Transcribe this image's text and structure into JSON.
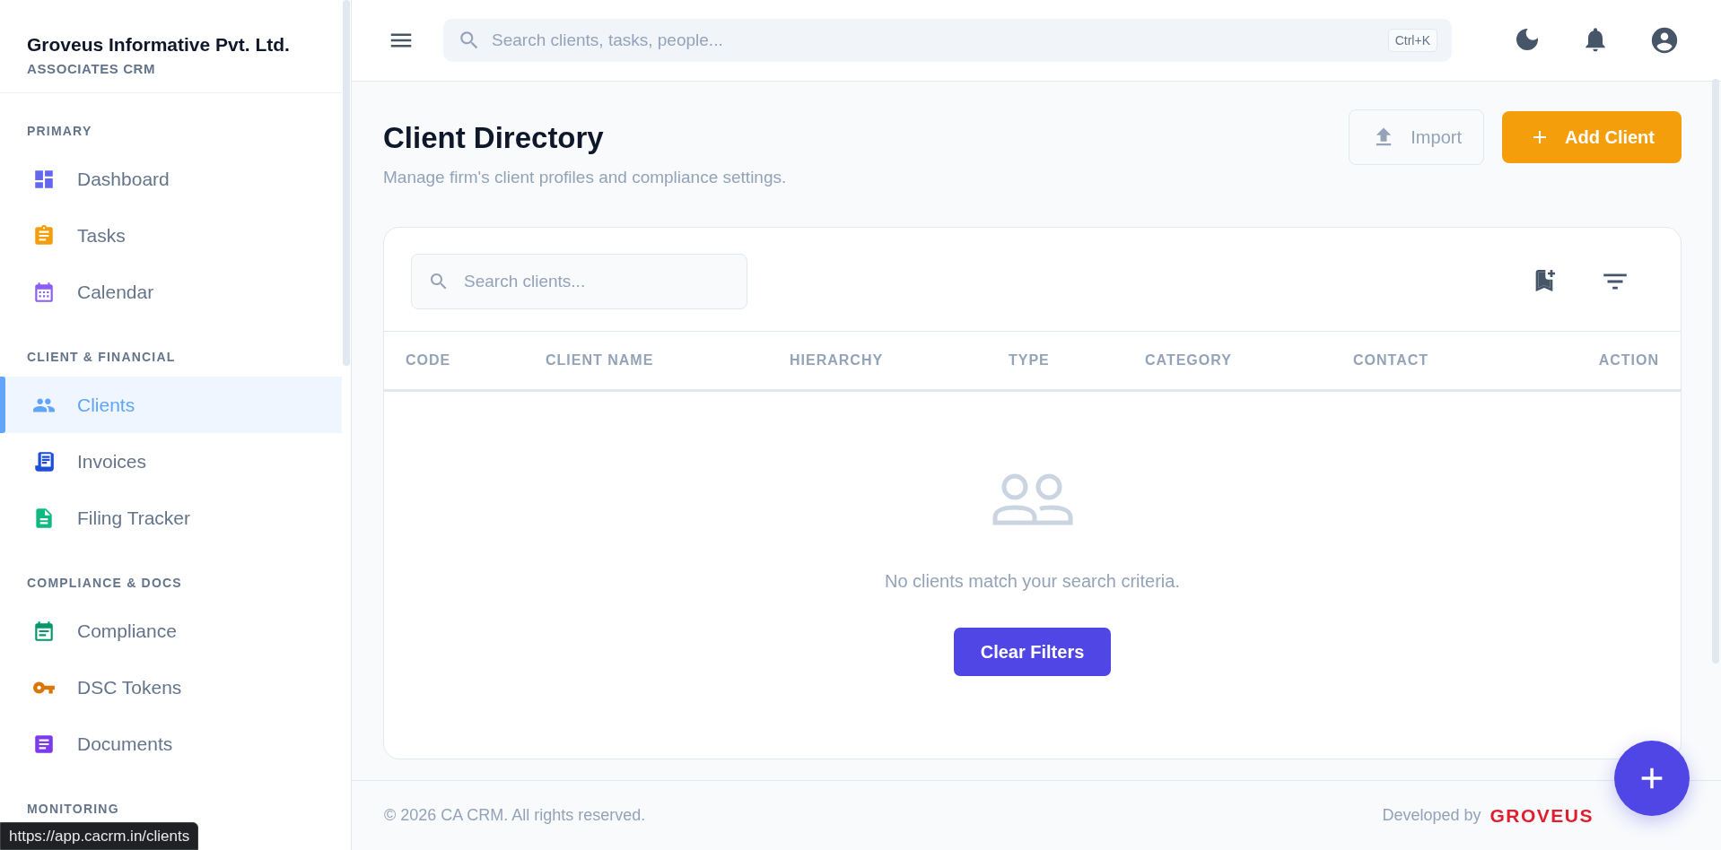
{
  "brand": {
    "title": "Groveus Informative Pvt. Ltd.",
    "subtitle": "ASSOCIATES CRM"
  },
  "sidebar": {
    "sections": [
      {
        "label": "PRIMARY",
        "items": [
          {
            "label": "Dashboard",
            "color": "#6366f1",
            "selected": false
          },
          {
            "label": "Tasks",
            "color": "#f59e0b",
            "selected": false
          },
          {
            "label": "Calendar",
            "color": "#8b5cf6",
            "selected": false
          }
        ]
      },
      {
        "label": "CLIENT & FINANCIAL",
        "items": [
          {
            "label": "Clients",
            "color": "#60a5fa",
            "selected": true
          },
          {
            "label": "Invoices",
            "color": "#1d4ed8",
            "selected": false
          },
          {
            "label": "Filing Tracker",
            "color": "#10b981",
            "selected": false
          }
        ]
      },
      {
        "label": "COMPLIANCE & DOCS",
        "items": [
          {
            "label": "Compliance",
            "color": "#059669",
            "selected": false
          },
          {
            "label": "DSC Tokens",
            "color": "#d97706",
            "selected": false
          },
          {
            "label": "Documents",
            "color": "#7c3aed",
            "selected": false
          }
        ]
      },
      {
        "label": "MONITORING"
      }
    ]
  },
  "header": {
    "search": {
      "placeholder": "Search clients, tasks, people...",
      "shortcut": "Ctrl+K"
    }
  },
  "page": {
    "title": "Client Directory",
    "subtitle": "Manage firm's client profiles and compliance settings.",
    "buttons": [
      {
        "label": "Import",
        "kind": "secondary"
      },
      {
        "label": "Add Client",
        "kind": "primary"
      }
    ]
  },
  "card": {
    "search": {
      "placeholder": "Search clients..."
    },
    "table": {
      "columns": [
        "CODE",
        "CLIENT NAME",
        "HIERARCHY",
        "TYPE",
        "CATEGORY",
        "CONTACT",
        "ACTION"
      ]
    },
    "empty": {
      "message": "No clients match your search criteria.",
      "button": "Clear Filters"
    }
  },
  "footer": {
    "copyright": "© 2026 CA CRM. All rights reserved.",
    "credit": "Developed by",
    "logo": "GROVEUS"
  },
  "status_url": "https://app.cacrm.in/clients"
}
